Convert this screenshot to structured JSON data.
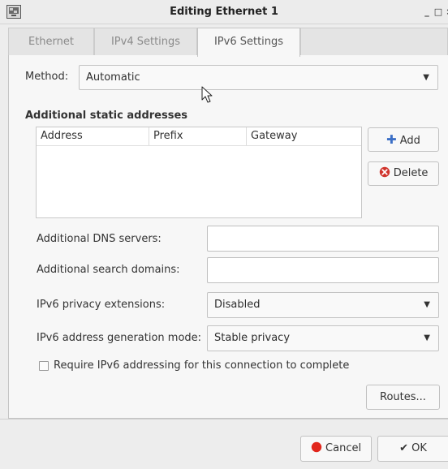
{
  "window": {
    "title": "Editing Ethernet 1",
    "minimize": "_",
    "maximize": "□",
    "close": "×"
  },
  "tabs": [
    {
      "label": "Ethernet"
    },
    {
      "label": "IPv4 Settings"
    },
    {
      "label": "IPv6 Settings",
      "active": true
    }
  ],
  "method": {
    "label": "Method:",
    "value": "Automatic"
  },
  "static_addresses": {
    "heading": "Additional static addresses",
    "columns": [
      "Address",
      "Prefix",
      "Gateway"
    ],
    "rows": [],
    "add_label": "Add",
    "delete_label": "Delete"
  },
  "dns": {
    "label": "Additional DNS servers:",
    "value": ""
  },
  "search_domains": {
    "label": "Additional search domains:",
    "value": ""
  },
  "privacy": {
    "label": "IPv6 privacy extensions:",
    "value": "Disabled"
  },
  "addr_gen": {
    "label": "IPv6 address generation mode:",
    "value": "Stable privacy"
  },
  "require": {
    "label": "Require IPv6 addressing for this connection to complete",
    "checked": false
  },
  "routes_label": "Routes...",
  "footer": {
    "cancel_label": "Cancel",
    "ok_label": "OK"
  },
  "colors": {
    "add_icon": "#3b6fc6",
    "delete_icon": "#d0342c",
    "cancel_icon": "#e1261c"
  }
}
